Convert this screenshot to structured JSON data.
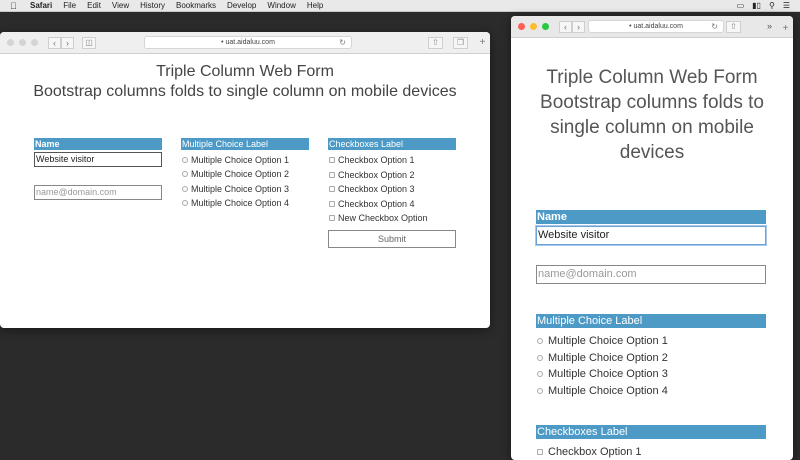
{
  "menubar": {
    "app": "Safari",
    "items": [
      "File",
      "Edit",
      "View",
      "History",
      "Bookmarks",
      "Develop",
      "Window",
      "Help"
    ]
  },
  "browser": {
    "url": "uat.aidaluu.com"
  },
  "page": {
    "title_line1": "Triple Column Web Form",
    "title_line2": "Bootstrap columns folds to single column on mobile devices",
    "mobile_title_lines": [
      "Triple Column Web Form",
      "Bootstrap columns folds to",
      "single column on mobile",
      "devices"
    ],
    "name_label": "Name",
    "name_value": "Website visitor",
    "email_placeholder": "name@domain.com",
    "mc_label": "Multiple Choice Label",
    "mc_options": [
      "Multiple Choice Option 1",
      "Multiple Choice Option 2",
      "Multiple Choice Option 3",
      "Multiple Choice Option 4"
    ],
    "cb_label": "Checkboxes Label",
    "cb_options": [
      "Checkbox Option 1",
      "Checkbox Option 2",
      "Checkbox Option 3",
      "Checkbox Option 4",
      "New Checkbox Option"
    ],
    "submit_label": "Submit"
  },
  "colors": {
    "label_bar": "#4d9ac6",
    "desktop_bg": "#2b2b2b"
  }
}
